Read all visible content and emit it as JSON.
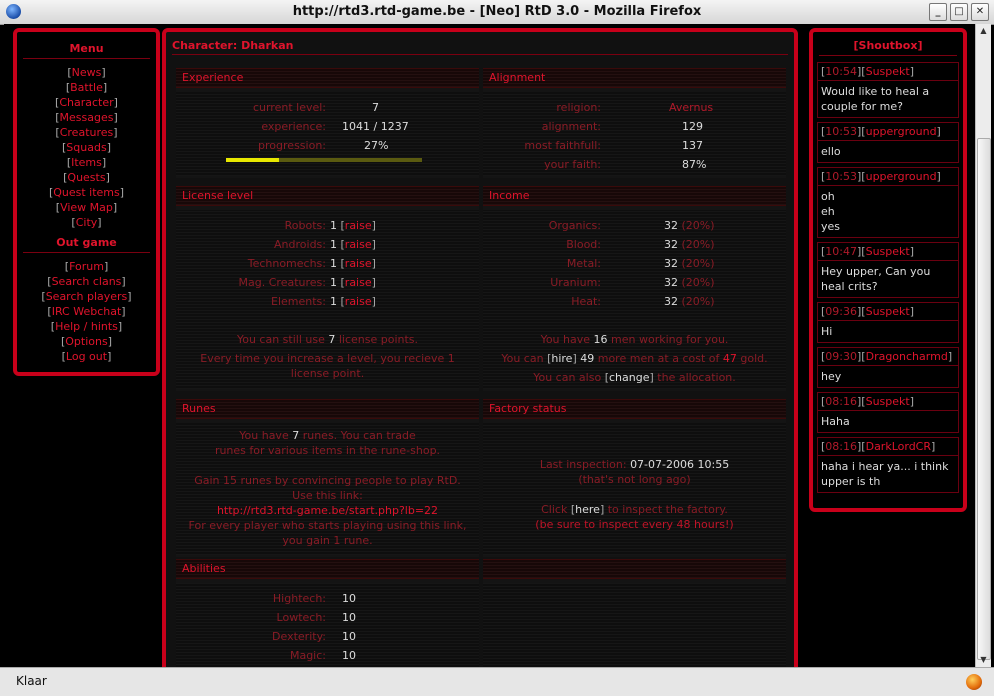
{
  "window": {
    "title": "http://rtd3.rtd-game.be - [Neo] RtD 3.0 - Mozilla Firefox",
    "btn_min": "_",
    "btn_max": "□",
    "btn_close": "✕"
  },
  "status": {
    "text": "Klaar"
  },
  "menu": {
    "title": "Menu",
    "items": [
      "News",
      "Battle",
      "Character",
      "Messages",
      "Creatures",
      "Squads",
      "Items",
      "Quests",
      "Quest items",
      "View Map",
      "City"
    ],
    "out_title": "Out game",
    "out_items": [
      "Forum",
      "Search clans",
      "Search players",
      "IRC Webchat",
      "Help / hints",
      "Options",
      "Log out"
    ]
  },
  "character": {
    "header": "Character: Dharkan"
  },
  "experience": {
    "title": "Experience",
    "level_label": "current level:",
    "level": "7",
    "exp_label": "experience:",
    "exp": "1041 / 1237",
    "prog_label": "progression:",
    "prog": "27%",
    "prog_fraction": 0.27
  },
  "alignment": {
    "title": "Alignment",
    "religion_label": "religion:",
    "religion": "Avernus",
    "alignment_label": "alignment:",
    "alignment": "129",
    "faithful_label": "most faithfull:",
    "faithful": "137",
    "faith_label": "your faith:",
    "faith": "87%"
  },
  "license": {
    "title": "License level",
    "rows": [
      {
        "label": "Robots:",
        "value": "1",
        "action": "raise"
      },
      {
        "label": "Androids:",
        "value": "1",
        "action": "raise"
      },
      {
        "label": "Technomechs:",
        "value": "1",
        "action": "raise"
      },
      {
        "label": "Mag. Creatures:",
        "value": "1",
        "action": "raise"
      },
      {
        "label": "Elements:",
        "value": "1",
        "action": "raise"
      }
    ],
    "points_pre": "You can still use",
    "points": "7",
    "points_post": "license points.",
    "note": "Every time you increase a level, you recieve 1 license point."
  },
  "income": {
    "title": "Income",
    "rows": [
      {
        "label": "Organics:",
        "value": "32",
        "pct": "(20%)"
      },
      {
        "label": "Blood:",
        "value": "32",
        "pct": "(20%)"
      },
      {
        "label": "Metal:",
        "value": "32",
        "pct": "(20%)"
      },
      {
        "label": "Uranium:",
        "value": "32",
        "pct": "(20%)"
      },
      {
        "label": "Heat:",
        "value": "32",
        "pct": "(20%)"
      }
    ],
    "men_pre": "You have",
    "men": "16",
    "men_post": "men working for you.",
    "hire_pre": "You can",
    "hire_link": "hire",
    "hire_count": "49",
    "hire_mid": "more men at a cost of",
    "hire_cost": "47",
    "hire_post": "gold.",
    "change_pre": "You can also",
    "change_link": "change",
    "change_post": "the allocation."
  },
  "runes": {
    "title": "Runes",
    "have_pre": "You have",
    "have": "7",
    "have_post": "runes. You can trade",
    "line2": "runes for various items in the rune-shop.",
    "line3": "Gain 15 runes by convincing people to play RtD.",
    "line4": "Use this link:",
    "link": "http://rtd3.rtd-game.be/start.php?lb=22",
    "line5": "For every player who starts playing using this link,",
    "line6": "you gain 1 rune."
  },
  "factory": {
    "title": "Factory status",
    "insp_label": "Last inspection:",
    "insp": "07-07-2006 10:55",
    "insp_note": "(that's not long ago)",
    "click_pre": "Click",
    "click_link": "here",
    "click_post": "to inspect the factory.",
    "click_note": "(be sure to inspect every 48 hours!)"
  },
  "abilities": {
    "title": "Abilities",
    "rows": [
      {
        "label": "Hightech:",
        "value": "10"
      },
      {
        "label": "Lowtech:",
        "value": "10"
      },
      {
        "label": "Dexterity:",
        "value": "10"
      },
      {
        "label": "Magic:",
        "value": "10"
      }
    ]
  },
  "shoutbox": {
    "title": "[Shoutbox]",
    "messages": [
      {
        "time": "10:54",
        "user": "Suspekt",
        "text": "Would like to heal a couple for me?"
      },
      {
        "time": "10:53",
        "user": "upperground",
        "text": "ello"
      },
      {
        "time": "10:53",
        "user": "upperground",
        "text": "oh\neh\nyes"
      },
      {
        "time": "10:47",
        "user": "Suspekt",
        "text": "Hey upper, Can you heal crits?"
      },
      {
        "time": "09:36",
        "user": "Suspekt",
        "text": "Hi"
      },
      {
        "time": "09:30",
        "user": "Dragoncharmd",
        "text": "hey"
      },
      {
        "time": "08:16",
        "user": "Suspekt",
        "text": "Haha"
      },
      {
        "time": "08:16",
        "user": "DarkLordCR",
        "text": "haha i hear ya... i think upper is th"
      }
    ]
  }
}
